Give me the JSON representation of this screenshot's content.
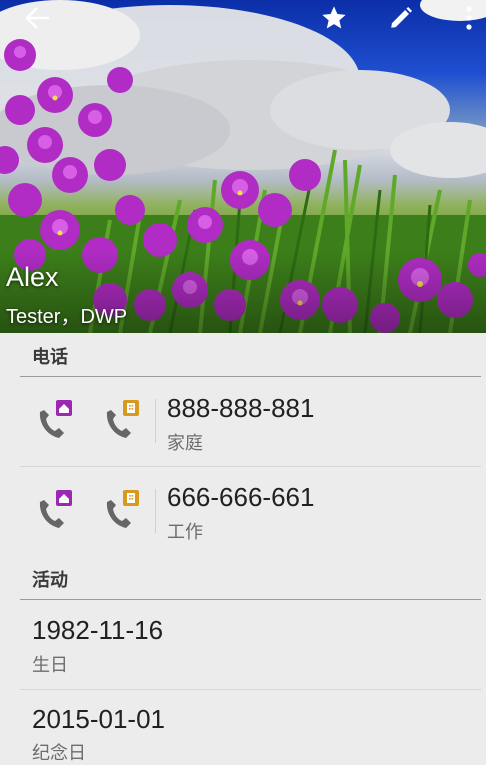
{
  "contact": {
    "name": "Alex",
    "subtitle": "Tester，DWP"
  },
  "toolbar": {
    "back_icon": "arrow-left-icon",
    "star_icon": "star-icon",
    "edit_icon": "pencil-icon",
    "more_icon": "more-vertical-icon"
  },
  "phone_section": {
    "header": "电话",
    "items": [
      {
        "number": "888-888-881",
        "type": "家庭"
      },
      {
        "number": "666-666-661",
        "type": "工作"
      }
    ]
  },
  "events_section": {
    "header": "活动",
    "items": [
      {
        "date": "1982-11-16",
        "type": "生日"
      },
      {
        "date": "2015-01-01",
        "type": "纪念日"
      }
    ]
  },
  "colors": {
    "background": "#ececec",
    "call_icon": "#666666",
    "home_badge": "#9c27b0",
    "work_badge": "#d89a1e"
  }
}
